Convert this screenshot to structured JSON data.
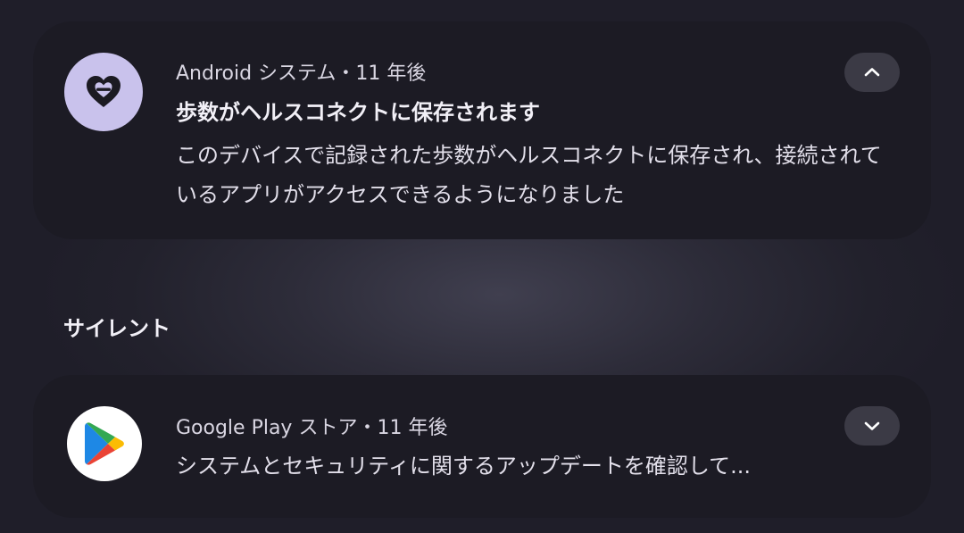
{
  "notifications": [
    {
      "app_name": "Android システム",
      "separator": "・",
      "time": "11 年後",
      "title": "歩数がヘルスコネクトに保存されます",
      "body": "このデバイスで記録された歩数がヘルスコネクトに保存され、接続されているアプリがアクセスできるようになりました",
      "icon": "health-connect-icon",
      "icon_bg": "#c9c2ec",
      "expanded": true,
      "toggle_icon": "chevron-up-icon"
    }
  ],
  "silent_section": {
    "title": "サイレント",
    "notifications": [
      {
        "app_name": "Google Play ストア",
        "separator": "・",
        "time": "11 年後",
        "preview": "システムとセキュリティに関するアップデートを確認して...",
        "icon": "google-play-icon",
        "icon_bg": "#ffffff",
        "expanded": false,
        "toggle_icon": "chevron-down-icon"
      }
    ]
  },
  "colors": {
    "card_bg": "#1c1b24",
    "button_bg": "#3b3a45",
    "text_primary": "#f2f0f7",
    "text_secondary": "#d9d6e2"
  }
}
